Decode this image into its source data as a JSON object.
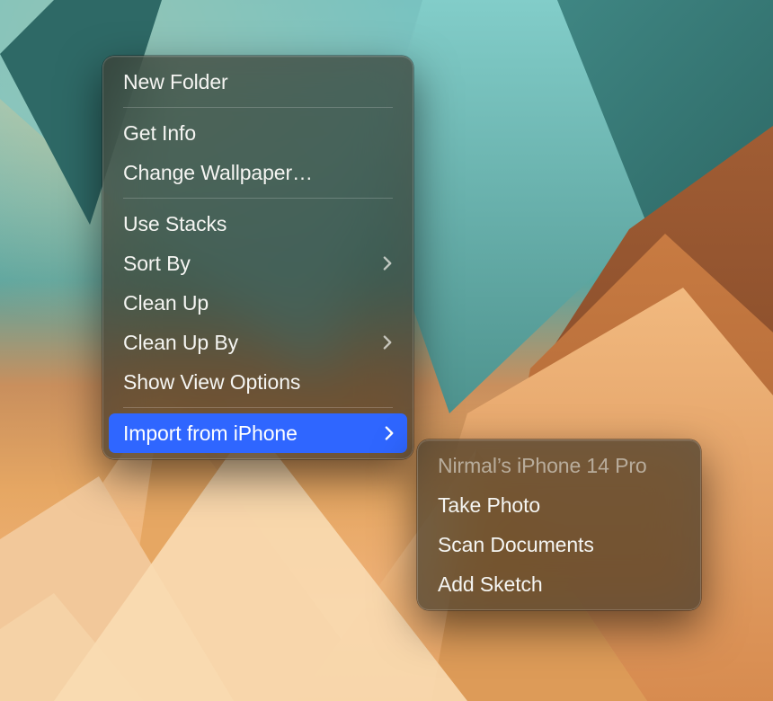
{
  "menu": {
    "items": [
      {
        "label": "New Folder"
      },
      {
        "label": "Get Info"
      },
      {
        "label": "Change Wallpaper…"
      },
      {
        "label": "Use Stacks"
      },
      {
        "label": "Sort By"
      },
      {
        "label": "Clean Up"
      },
      {
        "label": "Clean Up By"
      },
      {
        "label": "Show View Options"
      },
      {
        "label": "Import from iPhone"
      }
    ]
  },
  "submenu": {
    "header": "Nirmal’s iPhone 14 Pro",
    "items": [
      {
        "label": "Take Photo"
      },
      {
        "label": "Scan Documents"
      },
      {
        "label": "Add Sketch"
      }
    ]
  }
}
